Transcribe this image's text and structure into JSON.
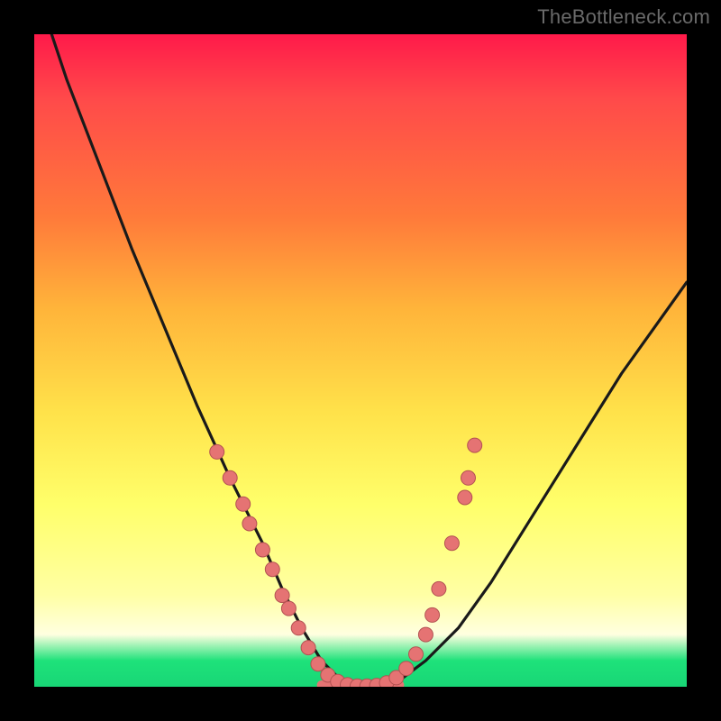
{
  "watermark": "TheBottleneck.com",
  "colors": {
    "background": "#000000",
    "gradient_top": "#ff1a4a",
    "gradient_mid": "#ffe24a",
    "gradient_bottom": "#18d676",
    "curve": "#1a1a1a",
    "dot_fill": "#e57373",
    "dot_stroke": "#b35252"
  },
  "chart_data": {
    "type": "line",
    "title": "",
    "xlabel": "",
    "ylabel": "",
    "xlim": [
      0,
      100
    ],
    "ylim": [
      0,
      100
    ],
    "grid": false,
    "legend": false,
    "series": [
      {
        "name": "bottleneck-curve",
        "x": [
          0,
          5,
          10,
          15,
          20,
          25,
          30,
          35,
          38,
          41,
          44,
          47,
          50,
          53,
          56,
          60,
          65,
          70,
          75,
          80,
          85,
          90,
          95,
          100
        ],
        "y": [
          108,
          93,
          80,
          67,
          55,
          43,
          32,
          22,
          15,
          9,
          4,
          1,
          0,
          0,
          1,
          4,
          9,
          16,
          24,
          32,
          40,
          48,
          55,
          62
        ]
      }
    ],
    "flat_segment": {
      "x_start": 44,
      "x_end": 56,
      "y": 0
    },
    "dots": [
      {
        "x": 28,
        "y": 36
      },
      {
        "x": 30,
        "y": 32
      },
      {
        "x": 32,
        "y": 28
      },
      {
        "x": 33,
        "y": 25
      },
      {
        "x": 35,
        "y": 21
      },
      {
        "x": 36.5,
        "y": 18
      },
      {
        "x": 38,
        "y": 14
      },
      {
        "x": 39,
        "y": 12
      },
      {
        "x": 40.5,
        "y": 9
      },
      {
        "x": 42,
        "y": 6
      },
      {
        "x": 43.5,
        "y": 3.5
      },
      {
        "x": 45,
        "y": 1.8
      },
      {
        "x": 46.5,
        "y": 0.8
      },
      {
        "x": 48,
        "y": 0.3
      },
      {
        "x": 49.5,
        "y": 0.1
      },
      {
        "x": 51,
        "y": 0.1
      },
      {
        "x": 52.5,
        "y": 0.2
      },
      {
        "x": 54,
        "y": 0.6
      },
      {
        "x": 55.5,
        "y": 1.4
      },
      {
        "x": 57,
        "y": 2.8
      },
      {
        "x": 58.5,
        "y": 5
      },
      {
        "x": 60,
        "y": 8
      },
      {
        "x": 61,
        "y": 11
      },
      {
        "x": 62,
        "y": 15
      },
      {
        "x": 64,
        "y": 22
      },
      {
        "x": 66,
        "y": 29
      },
      {
        "x": 66.5,
        "y": 32
      },
      {
        "x": 67.5,
        "y": 37
      }
    ]
  }
}
